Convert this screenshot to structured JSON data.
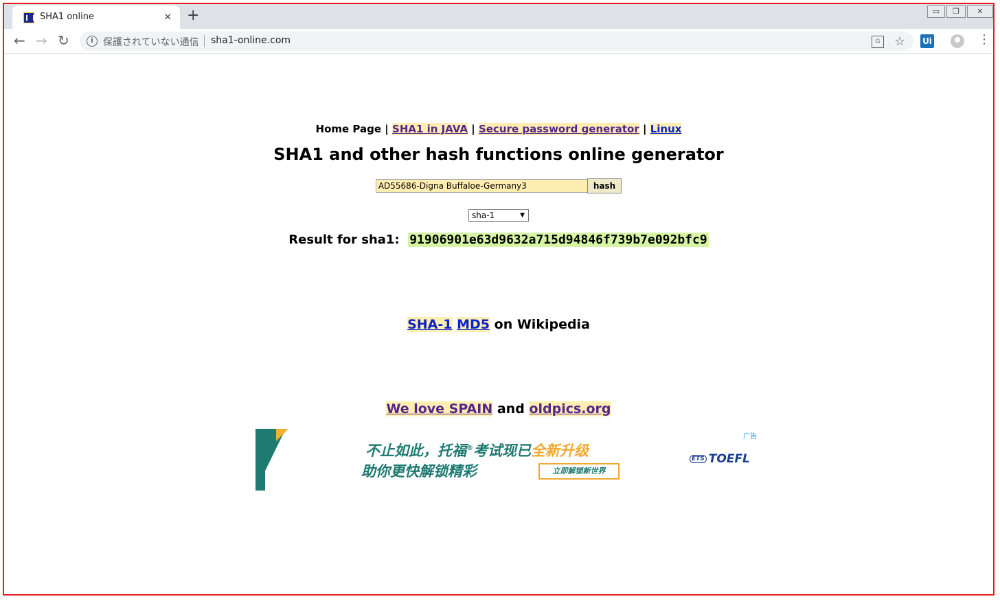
{
  "browser": {
    "tab_title": "SHA1 online",
    "tab_close": "×",
    "new_tab": "+",
    "security_text": "保護されていない通信",
    "url": "sha1-online.com",
    "ext_label": "Ui"
  },
  "nav": {
    "home": "Home Page",
    "sep": "|",
    "java": "SHA1 in JAVA",
    "password": "Secure password generator",
    "linux": "Linux"
  },
  "page_title": "SHA1 and other hash functions online generator",
  "form": {
    "input_value": "AD55686-Digna Buffaloe-Germany3",
    "button_label": "hash",
    "selected_algo": "sha-1"
  },
  "result": {
    "label": "Result for sha1:",
    "hash": "91906901e63d9632a715d94846f739b7e092bfc9"
  },
  "wiki": {
    "sha1": "SHA-1",
    "md5": "MD5",
    "suffix": "on Wikipedia"
  },
  "spain": {
    "link1": "We love SPAIN",
    "and": "and",
    "link2": "oldpics.org"
  },
  "ad": {
    "tag": "广告",
    "line1_a": "不止如此，托福",
    "line1_reg": "®",
    "line1_b": "考试现已",
    "line1_orange": "全新升级",
    "line2": "助你更快解锁精彩",
    "cta": "立即解锁新世界",
    "logo_ets": "ETS",
    "logo": "TOEFL"
  },
  "colors": {
    "frame": "#e21b1b",
    "highlight": "#ffeeb2",
    "result_bg": "#d6f5a4",
    "link_purple": "#55268a",
    "link_blue": "#0b24c9"
  }
}
